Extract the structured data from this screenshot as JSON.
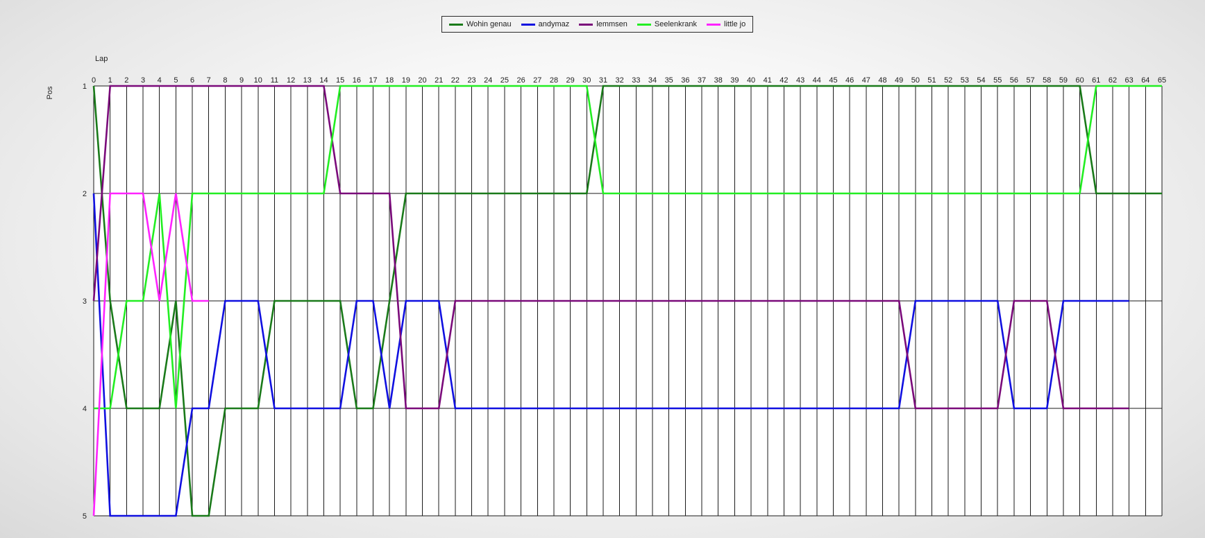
{
  "chart_data": {
    "type": "line",
    "title": "",
    "xlabel": "Lap",
    "ylabel": "Pos",
    "xlim": [
      0,
      65
    ],
    "ylim": [
      1,
      5
    ],
    "y_inverted": true,
    "grid": true,
    "legend_position": "top-center",
    "x_ticks": [
      0,
      1,
      2,
      3,
      4,
      5,
      6,
      7,
      8,
      9,
      10,
      11,
      12,
      13,
      14,
      15,
      16,
      17,
      18,
      19,
      20,
      21,
      22,
      23,
      24,
      25,
      26,
      27,
      28,
      29,
      30,
      31,
      32,
      33,
      34,
      35,
      36,
      37,
      38,
      39,
      40,
      41,
      42,
      43,
      44,
      45,
      46,
      47,
      48,
      49,
      50,
      51,
      52,
      53,
      54,
      55,
      56,
      57,
      58,
      59,
      60,
      61,
      62,
      63,
      64,
      65
    ],
    "y_ticks": [
      1,
      2,
      3,
      4,
      5
    ],
    "series": [
      {
        "name": "Wohin genau",
        "color": "#1a7a1a",
        "points": [
          [
            0,
            1
          ],
          [
            1,
            3
          ],
          [
            2,
            4
          ],
          [
            4,
            4
          ],
          [
            5,
            3
          ],
          [
            6,
            5
          ],
          [
            7,
            5
          ],
          [
            8,
            4
          ],
          [
            10,
            4
          ],
          [
            11,
            3
          ],
          [
            15,
            3
          ],
          [
            16,
            4
          ],
          [
            17,
            4
          ],
          [
            19,
            2
          ],
          [
            30,
            2
          ],
          [
            31,
            1
          ],
          [
            60,
            1
          ],
          [
            61,
            2
          ],
          [
            65,
            2
          ]
        ]
      },
      {
        "name": "andymaz",
        "color": "#1010e0",
        "points": [
          [
            0,
            2
          ],
          [
            1,
            5
          ],
          [
            5,
            5
          ],
          [
            6,
            4
          ],
          [
            7,
            4
          ],
          [
            8,
            3
          ],
          [
            10,
            3
          ],
          [
            11,
            4
          ],
          [
            15,
            4
          ],
          [
            16,
            3
          ],
          [
            17,
            3
          ],
          [
            18,
            4
          ],
          [
            19,
            3
          ],
          [
            21,
            3
          ],
          [
            22,
            4
          ],
          [
            49,
            4
          ],
          [
            50,
            3
          ],
          [
            55,
            3
          ],
          [
            56,
            4
          ],
          [
            58,
            4
          ],
          [
            59,
            3
          ],
          [
            63,
            3
          ]
        ]
      },
      {
        "name": "lemmsen",
        "color": "#7a0a7a",
        "points": [
          [
            0,
            3
          ],
          [
            1,
            1
          ],
          [
            14,
            1
          ],
          [
            15,
            2
          ],
          [
            18,
            2
          ],
          [
            19,
            4
          ],
          [
            21,
            4
          ],
          [
            22,
            3
          ],
          [
            49,
            3
          ],
          [
            50,
            4
          ],
          [
            55,
            4
          ],
          [
            56,
            3
          ],
          [
            58,
            3
          ],
          [
            59,
            4
          ],
          [
            63,
            4
          ]
        ]
      },
      {
        "name": "Seelenkrank",
        "color": "#22ee22",
        "points": [
          [
            0,
            4
          ],
          [
            1,
            4
          ],
          [
            2,
            3
          ],
          [
            3,
            3
          ],
          [
            4,
            2
          ],
          [
            5,
            4
          ],
          [
            6,
            2
          ],
          [
            14,
            2
          ],
          [
            15,
            1
          ],
          [
            30,
            1
          ],
          [
            31,
            2
          ],
          [
            60,
            2
          ],
          [
            61,
            1
          ],
          [
            65,
            1
          ]
        ]
      },
      {
        "name": "little jo",
        "color": "#ff22ff",
        "points": [
          [
            0,
            5
          ],
          [
            1,
            2
          ],
          [
            3,
            2
          ],
          [
            4,
            3
          ],
          [
            5,
            2
          ],
          [
            6,
            3
          ],
          [
            7,
            3
          ]
        ]
      }
    ]
  }
}
